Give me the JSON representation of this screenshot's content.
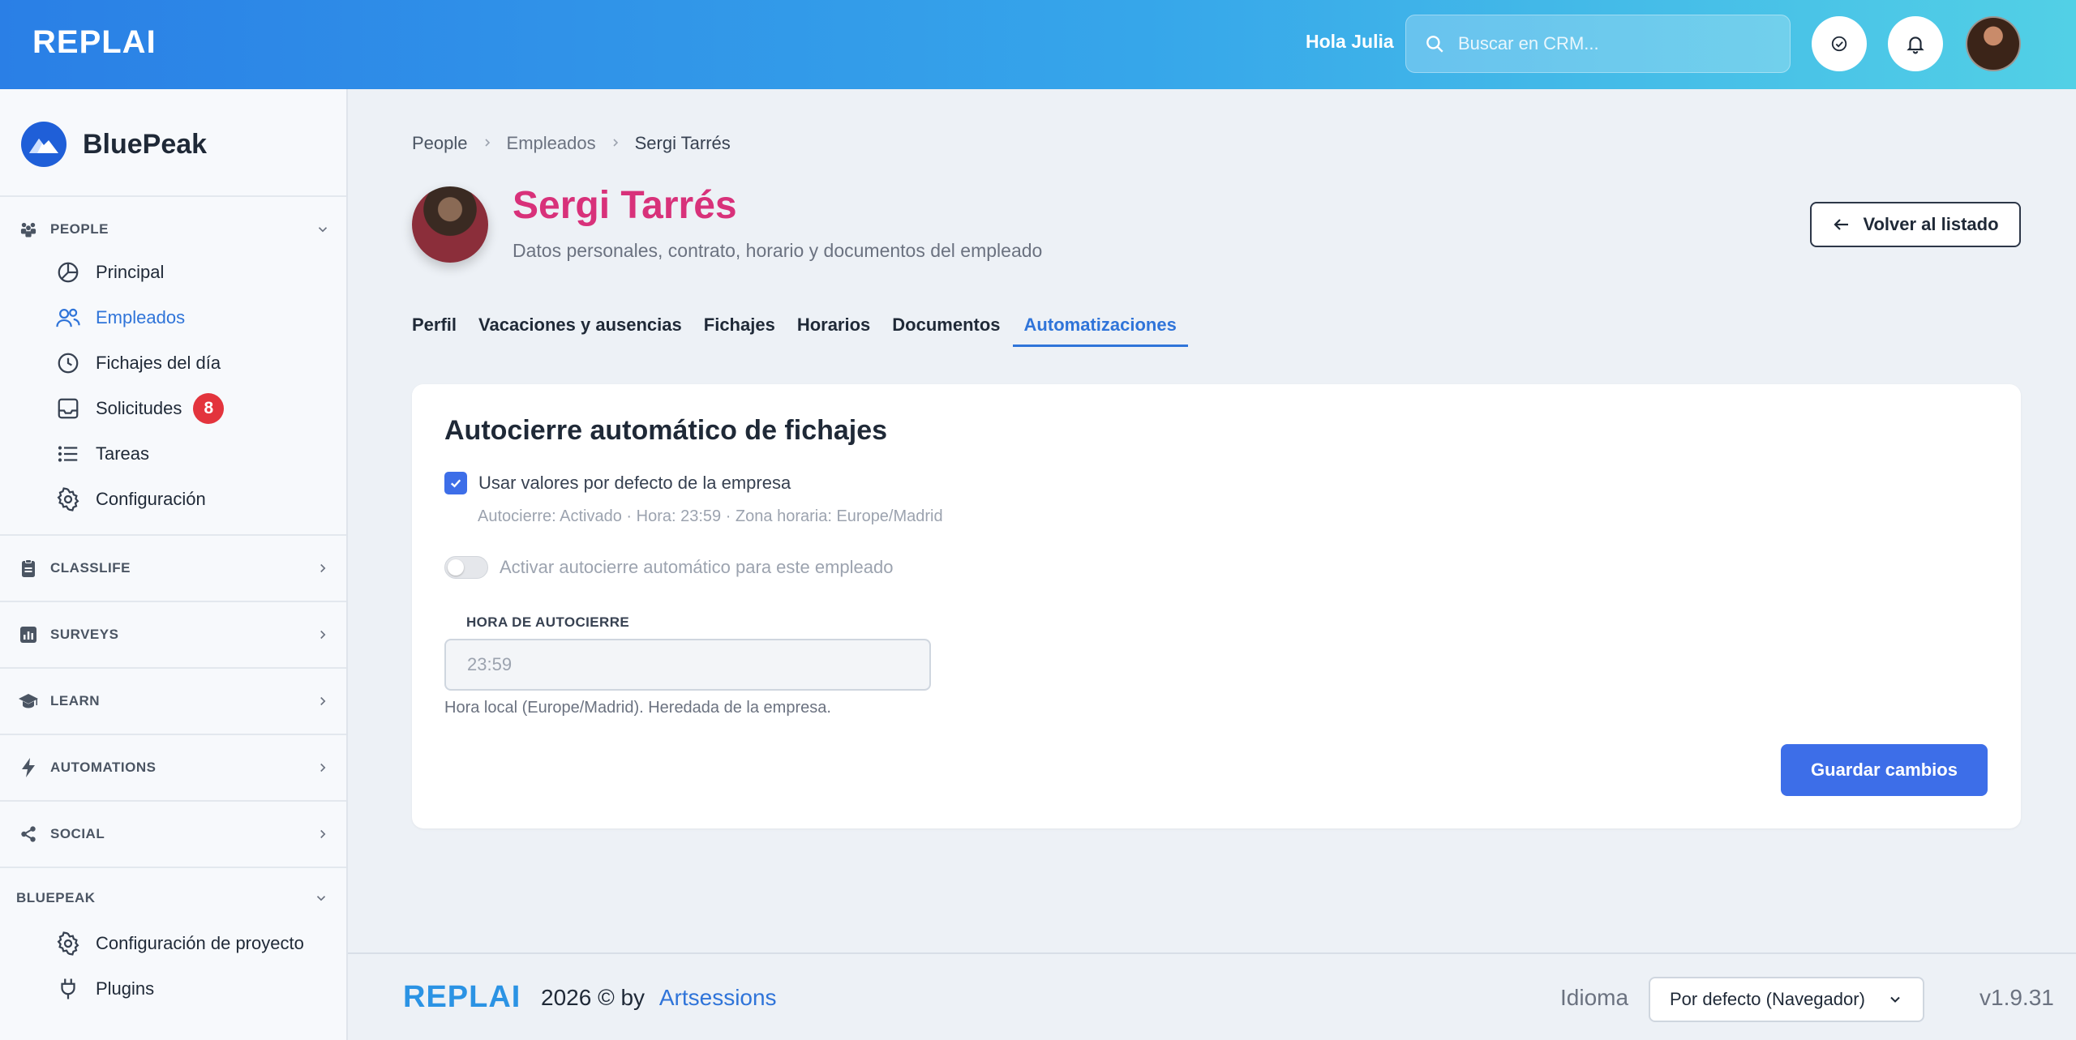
{
  "header": {
    "logo": "REPLAI",
    "greeting": "Hola Julia",
    "search_placeholder": "Buscar en CRM..."
  },
  "sidebar": {
    "org_name": "BluePeak",
    "sections": {
      "people": "PEOPLE",
      "classlife": "CLASSLIFE",
      "surveys": "SURVEYS",
      "learn": "LEARN",
      "automations": "AUTOMATIONS",
      "social": "SOCIAL",
      "bluepeak": "BLUEPEAK"
    },
    "people_items": {
      "principal": "Principal",
      "empleados": "Empleados",
      "fichajes": "Fichajes del día",
      "solicitudes": "Solicitudes",
      "solicitudes_badge": "8",
      "tareas": "Tareas",
      "configuracion": "Configuración"
    },
    "bluepeak_items": {
      "config_proyecto": "Configuración de proyecto",
      "plugins": "Plugins"
    }
  },
  "breadcrumb": {
    "root": "People",
    "mid": "Empleados",
    "current": "Sergi Tarrés"
  },
  "employee": {
    "name": "Sergi Tarrés",
    "subtitle": "Datos personales, contrato, horario y documentos del empleado"
  },
  "back_button": "Volver al listado",
  "tabs": {
    "perfil": "Perfil",
    "vacaciones": "Vacaciones y ausencias",
    "fichajes": "Fichajes",
    "horarios": "Horarios",
    "documentos": "Documentos",
    "automatizaciones": "Automatizaciones"
  },
  "card": {
    "title": "Autocierre automático de fichajes",
    "use_defaults_label": "Usar valores por defecto de la empresa",
    "defaults_info": "Autocierre: Activado · Hora: 23:59 · Zona horaria: Europe/Madrid",
    "toggle_label": "Activar autocierre automático para este empleado",
    "field_label": "HORA DE AUTOCIERRE",
    "field_value": "23:59",
    "field_help": "Hora local (Europe/Madrid). Heredada de la empresa.",
    "save_label": "Guardar cambios"
  },
  "footer": {
    "logo": "REPLAI",
    "copyright": "2026 © by",
    "link": "Artsessions",
    "language_label": "Idioma",
    "language_value": "Por defecto (Navegador)",
    "version": "v1.9.31"
  },
  "colors": {
    "accent": "#3d6ee8",
    "name_pink": "#d8317a",
    "badge_red": "#e3343d"
  }
}
